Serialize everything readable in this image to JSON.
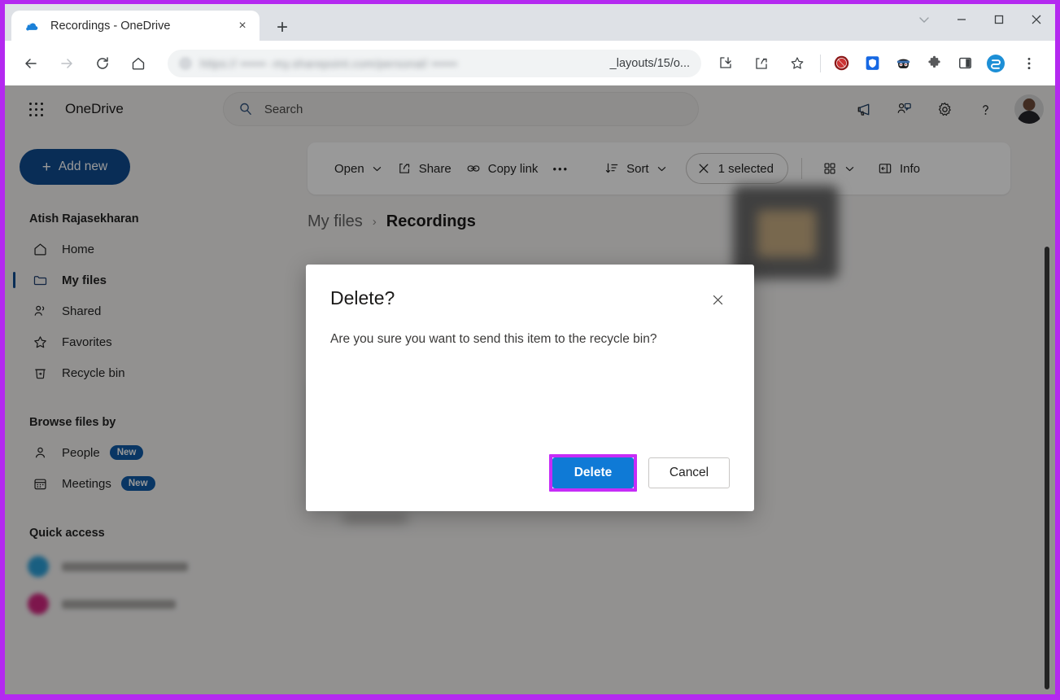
{
  "browser": {
    "tab": {
      "title": "Recordings - OneDrive",
      "favicon": "onedrive-cloud-icon",
      "close_label": "×"
    },
    "new_tab_label": "+",
    "window_controls": {
      "collapse": "⌄",
      "minimize": "–",
      "maximize": "□",
      "close": "✕"
    },
    "nav": {
      "back": "←",
      "forward": "→",
      "reload": "↻",
      "home": "⌂"
    },
    "omnibox": {
      "url_visible_tail": "_layouts/15/o...",
      "url_blurred": "https://  ••••••  -my.sharepoint.com/personal/ ••••••"
    },
    "toolbar_icons": [
      "download-icon",
      "share-icon",
      "bookmark-star-icon",
      "adblock-icon",
      "password-manager-icon",
      "ninja-extension-icon",
      "extensions-puzzle-icon",
      "split-screen-icon",
      "sidebar-ai-icon",
      "browser-menu-icon"
    ]
  },
  "header": {
    "waffle_label": "app-launcher",
    "brand": "OneDrive",
    "search": {
      "placeholder": "Search",
      "value": ""
    },
    "icons": [
      "megaphone-icon",
      "feedback-icon",
      "settings-gear-icon",
      "help-question-icon"
    ],
    "avatar_alt": "user-avatar"
  },
  "sidebar": {
    "add_new_label": "Add new",
    "add_new_plus": "+",
    "account_name": "Atish Rajasekharan",
    "items": [
      {
        "label": "Home",
        "icon": "home-icon",
        "active": false
      },
      {
        "label": "My files",
        "icon": "folder-icon",
        "active": true
      },
      {
        "label": "Shared",
        "icon": "people-icon",
        "active": false
      },
      {
        "label": "Favorites",
        "icon": "star-icon",
        "active": false
      },
      {
        "label": "Recycle bin",
        "icon": "recycle-bin-icon",
        "active": false
      }
    ],
    "browse_title": "Browse files by",
    "browse_items": [
      {
        "label": "People",
        "icon": "person-icon",
        "badge": "New"
      },
      {
        "label": "Meetings",
        "icon": "calendar-icon",
        "badge": "New"
      }
    ],
    "quick_access_title": "Quick access"
  },
  "commandbar": {
    "open": {
      "label": "Open",
      "chevron": "⌄"
    },
    "share": {
      "label": "Share",
      "icon": "share-icon"
    },
    "copy_link": {
      "label": "Copy link",
      "icon": "link-icon"
    },
    "more": {
      "label": "•••",
      "name": "more-commands"
    },
    "sort": {
      "label": "Sort",
      "icon": "sort-icon",
      "chevron": "⌄"
    },
    "selected": {
      "label": "1 selected",
      "icon": "clear-selection-icon"
    },
    "view": {
      "icon": "grid-view-icon",
      "chevron": "⌄"
    },
    "info": {
      "label": "Info",
      "icon": "info-panel-icon"
    }
  },
  "breadcrumb": {
    "root": "My files",
    "separator": "›",
    "current": "Recordings"
  },
  "dialog": {
    "title": "Delete?",
    "close_label": "✕",
    "message": "Are you sure you want to send this item to the recycle bin?",
    "primary_button": "Delete",
    "secondary_button": "Cancel"
  },
  "colors": {
    "annotation_purple": "#b429f0",
    "highlight_magenta": "#c62cf7",
    "primary_blue": "#0f7ad6",
    "brand_blue": "#0f4b8f",
    "badge_blue": "#0f5ba7"
  }
}
